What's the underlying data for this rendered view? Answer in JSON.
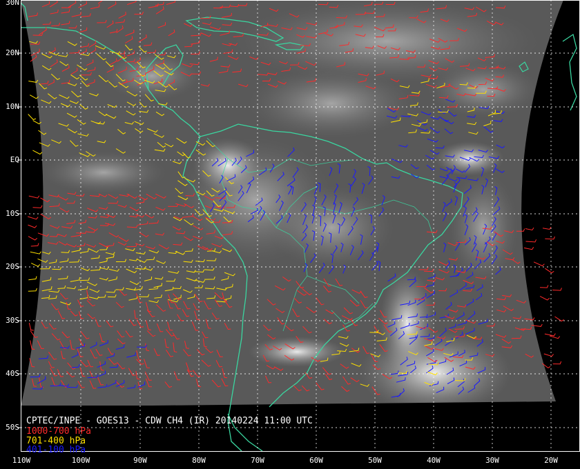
{
  "title": "CPTEC/INPE - GOES13 - CDW CH4 (IR) 20140224 11:00 UTC",
  "legend": [
    {
      "label": "1000-700 hPa",
      "color": "#ff2a2a"
    },
    {
      "label": "701-400 hPa",
      "color": "#ffe000"
    },
    {
      "label": "401-100 hPa",
      "color": "#1a1aff"
    }
  ],
  "lat_labels": [
    "30N",
    "20N",
    "10N",
    "EQ",
    "10S",
    "20S",
    "30S",
    "40S",
    "50S"
  ],
  "lon_labels": [
    "110W",
    "100W",
    "90W",
    "80W",
    "70W",
    "60W",
    "50W",
    "40W",
    "30W",
    "20W"
  ],
  "colors": {
    "coastline": "#3ad6a0",
    "grid": "#ffffff",
    "background": "#000000"
  }
}
